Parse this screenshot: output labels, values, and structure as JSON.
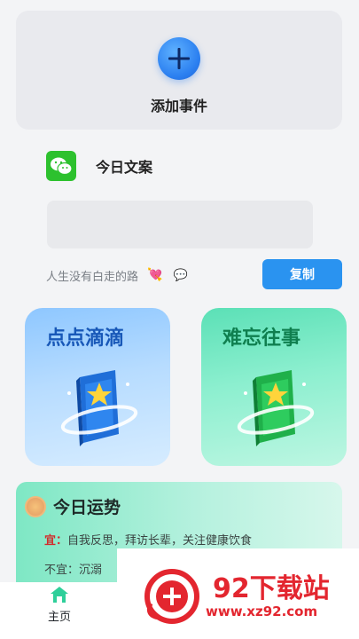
{
  "add_event": {
    "label": "添加事件",
    "icon": "plus-icon"
  },
  "wechat": {
    "title": "今日文案",
    "icon": "wechat-icon",
    "color": "#2dc12e"
  },
  "quote": {
    "text": "人生没有白走的路",
    "heart": "💘",
    "bubble": "💬"
  },
  "copy_button": {
    "label": "复制",
    "color": "#2a93f0"
  },
  "tiles": [
    {
      "title": "点点滴滴",
      "icon": "book-blue-icon"
    },
    {
      "title": "难忘往事",
      "icon": "book-green-icon"
    }
  ],
  "fortune": {
    "title": "今日运势",
    "icon": "sun-icon",
    "good_key": "宜：",
    "good_text": "自我反思，拜访长辈，关注健康饮食",
    "bad_text": "不宜：沉溺"
  },
  "tabbar": {
    "home_label": "主页",
    "home_icon": "home-icon"
  },
  "watermark": {
    "name": "92下载站",
    "url": "www.xz92.com"
  }
}
